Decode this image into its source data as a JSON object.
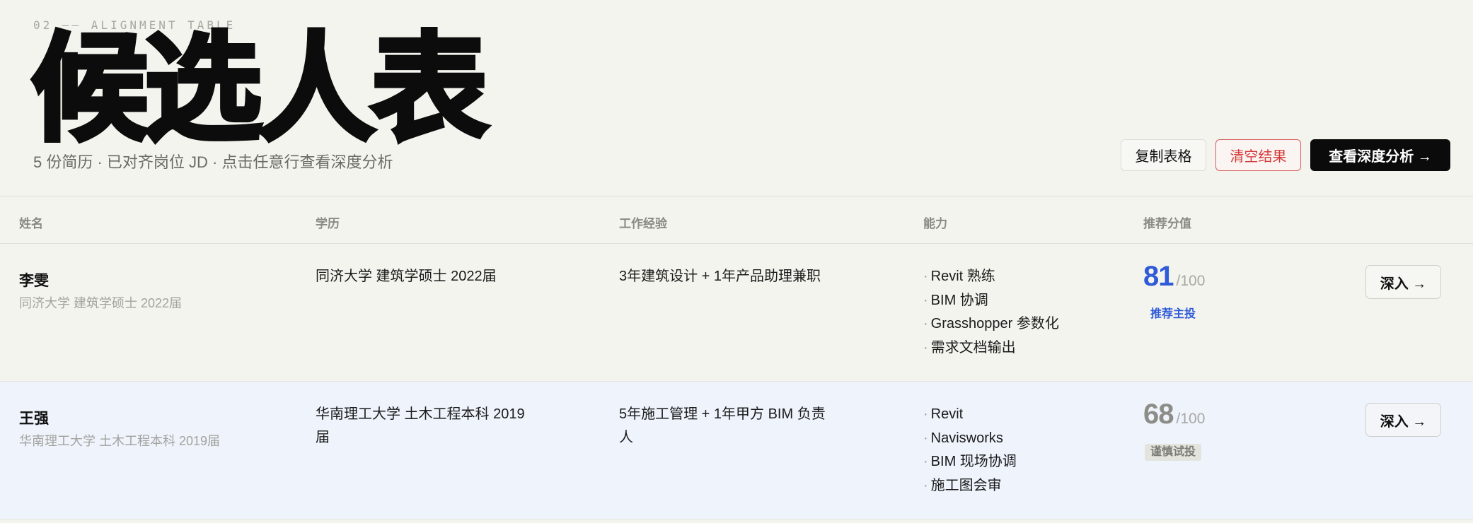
{
  "header": {
    "eyebrow": "02 —— ALIGNMENT TABLE",
    "title": "候选人表",
    "subtitle": "5 份简历 · 已对齐岗位 JD · 点击任意行查看深度分析"
  },
  "actions": {
    "copy_label": "复制表格",
    "clear_label": "清空结果",
    "analysis_label": "查看深度分析 →"
  },
  "table": {
    "columns": [
      "姓名",
      "学历",
      "工作经验",
      "能力",
      "推荐分值"
    ],
    "rows": [
      {
        "name": "李雯",
        "name_sub": "同济大学 建筑学硕士 2022届",
        "education": "同济大学 建筑学硕士 2022届",
        "experience": "3年建筑设计 + 1年产品助理兼职",
        "skills": [
          "Revit 熟练",
          "BIM 协调",
          "Grasshopper 参数化",
          "需求文档输出"
        ],
        "score": "81",
        "score_max": "/100",
        "tag": "推荐主投",
        "action": "深入 →"
      },
      {
        "name": "王强",
        "name_sub": "华南理工大学 土木工程本科 2019届",
        "education": "华南理工大学 土木工程本科 2019届",
        "experience": "5年施工管理 + 1年甲方 BIM 负责人",
        "skills": [
          "Revit",
          "Navisworks",
          "BIM 现场协调",
          "施工图会审"
        ],
        "score": "68",
        "score_max": "/100",
        "tag": "谨慎试投",
        "action": "深入 →"
      }
    ]
  },
  "skill_bullet": "·",
  "colors": {
    "background": "#f4f4ef",
    "row_highlight": "#eef3fc",
    "accent_blue": "#2f5bd8",
    "danger_red": "#d63a3a",
    "primary_black": "#0b0b0b"
  }
}
